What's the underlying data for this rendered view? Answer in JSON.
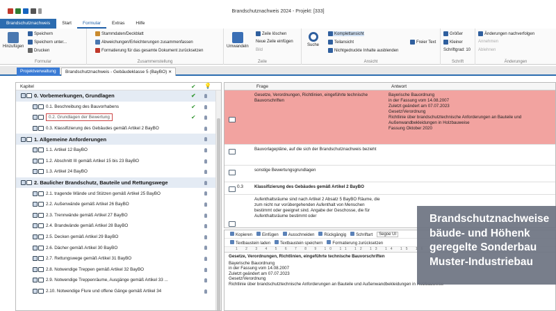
{
  "app": {
    "title": "Brandschutznachweis 2024 - Projekt: [333]"
  },
  "menu": {
    "file": "Brandschutznachweis",
    "tabs": [
      "Start",
      "Formular",
      "Extras",
      "Hilfe"
    ]
  },
  "ribbon": {
    "formular": {
      "hinzufuegen": "Hinzufügen",
      "speichern": "Speichern",
      "speichern_unter": "Speichern unter...",
      "drucken": "Drucken",
      "label": "Formular"
    },
    "zusammenstellung": {
      "stammdaten": "Stammdaten/Deckblatt",
      "abweichungen": "Abweichungen/Erleichterungen zusammenfassen",
      "formatierung": "Formatierung für das gesamte Dokument zurücksetzen",
      "label": "Zusammenstellung"
    },
    "zeile": {
      "umwandeln": "Umwandeln",
      "zeile_loeschen": "Zeile löschen",
      "neue_zeile": "Neue Zeile einfügen",
      "bild": "Bild",
      "label": "Zeile"
    },
    "ansicht": {
      "suche": "Suche",
      "komplettansicht": "Komplettansicht",
      "teilansicht": "Teilansicht",
      "nichtgedruckte": "Nichtgedruckte Inhalte ausblenden",
      "freier_text": "Freier Text",
      "label": "Ansicht"
    },
    "schrift": {
      "groesser": "Größer",
      "kleiner": "Kleiner",
      "schriftgrad": "Schriftgrad: 10",
      "label": "Schrift"
    },
    "aenderungen": {
      "nachverfolgen": "Änderungen nachverfolgen",
      "annehmen": "Annehmen",
      "ablehnen": "Ablehnen",
      "label": "Änderungen"
    }
  },
  "doctabs": [
    "Projektverwaltung",
    "Brandschutznachweis - Gebäudeklasse 5 (BayBO)"
  ],
  "tree": {
    "header": "Kapitel",
    "rows": [
      {
        "label": "0. Vorbemerkungen, Grundlagen",
        "heading": true,
        "check": true
      },
      {
        "label": "0.1. Beschreibung des Bauvorhabens",
        "heading": false,
        "check": true
      },
      {
        "label": "0.2. Grundlagen der Bewertung",
        "heading": false,
        "check": true
      },
      {
        "label": "0.3. Klassifizierung des Gebäudes gemäß Artikel 2 BayBO",
        "heading": false,
        "check": false
      },
      {
        "label": "1. Allgemeine Anforderungen",
        "heading": true,
        "check": false
      },
      {
        "label": "1.1. Artikel 12 BayBO",
        "heading": false,
        "check": false
      },
      {
        "label": "1.2. Abschnitt III gemäß Artikel 15 bis 23 BayBO",
        "heading": false,
        "check": false
      },
      {
        "label": "1.3. Artikel 24 BayBO",
        "heading": false,
        "check": false
      },
      {
        "label": "2. Baulicher Brandschutz, Bauteile und Rettungswege",
        "heading": true,
        "check": false
      },
      {
        "label": "2.1. tragende Wände und Stützen gemäß Artikel 25 BayBO",
        "heading": false,
        "check": false
      },
      {
        "label": "2.2. Außenwände gemäß Artikel 26 BayBO",
        "heading": false,
        "check": false
      },
      {
        "label": "2.3. Trennwände gemäß Artikel 27 BayBO",
        "heading": false,
        "check": false
      },
      {
        "label": "2.4. Brandwände gemäß Artikel 28 BayBO",
        "heading": false,
        "check": false
      },
      {
        "label": "2.5. Decken gemäß Artikel 29 BayBO",
        "heading": false,
        "check": false
      },
      {
        "label": "2.6. Dächer gemäß Artikel 30 BayBO",
        "heading": false,
        "check": false
      },
      {
        "label": "2.7. Rettungswege gemäß Artikel 31 BayBO",
        "heading": false,
        "check": false
      },
      {
        "label": "2.8. Notwendige Treppen gemäß Artikel 32 BayBO",
        "heading": false,
        "check": false
      },
      {
        "label": "2.9. Notwendige Treppenräume, Ausgänge gemäß Artikel 33 ...",
        "heading": false,
        "check": false
      },
      {
        "label": "2.10. Notwendige Flure und offene Gänge gemäß Artikel 34",
        "heading": false,
        "check": false
      }
    ]
  },
  "grid": {
    "col_frage": "Frage",
    "col_antwort": "Antwort",
    "rows": [
      {
        "num": "",
        "frage": "Gesetze, Verordnungen, Richtlinien, eingeführte technische Bauvorschriften",
        "antwort": "Bayerische Bauordnung\nin der Fassung vom 14.08.2007\nZuletzt geändert am 07.07.2023\nGesetz/Verordnung\nRichtlinie über brandschutztechnische Anforderungen an Bauteile und Außenwandbekleidungen in Holzbauweise\nFassung Oktober 2020"
      },
      {
        "num": "",
        "frage": "Bauvorlagepläne, auf die sich der Brandschutznachweis bezieht",
        "antwort": ""
      },
      {
        "num": "",
        "frage": "sonstige Bewertungsgrundlagen",
        "antwort": ""
      },
      {
        "num": "0.3",
        "frage": "Klassifizierung des Gebäudes gemäß Artikel 2 BayBO",
        "antwort": ""
      },
      {
        "num": "",
        "frage": "Aufenthaltsräume sind nach Artikel 2 Absatz 5 BayBO Räume, die zum nicht nur vorübergehenden Aufenthalt von Menschen bestimmt oder geeignet sind. Angabe der Geschosse, die für Aufenthaltsräume bestimmt oder",
        "antwort": ""
      }
    ]
  },
  "editor": {
    "toolbar1": [
      "Kopieren",
      "Einfügen",
      "Ausschneiden",
      "Rückgängig",
      "Schriftart",
      "Segoe UI"
    ],
    "toolbar2": [
      "Textbaustein laden",
      "Textbaustein speichern",
      "Formatierung zurücksetzen"
    ],
    "ruler": "1 2 3 4 5 6 7 8 9 10 11 12 13 14 15 16 17 18",
    "heading": "Gesetze, Verordnungen, Richtlinien, eingeführte technische Bauvorschriften",
    "lines": [
      "Bayerische Bauordnung",
      "in der Fassung vom 14.08.2007",
      "Zuletzt geändert am 07.07.2023",
      "Gesetz/Verordnung",
      "Richtlinie über brandschutztechnische Anforderungen an Bauteile und Außenwandbekleidungen in Holzbauweise"
    ]
  },
  "banner": {
    "lines": [
      "Brandschutznachweise",
      "bäude- und Höhenk",
      "geregelte Sonderbau",
      "Muster-Industriebau"
    ]
  },
  "colors": {
    "accent": "#2b6cb0",
    "highlight": "#f2a3a0",
    "banner": "#6e7482",
    "check": "#3a9a3a"
  }
}
